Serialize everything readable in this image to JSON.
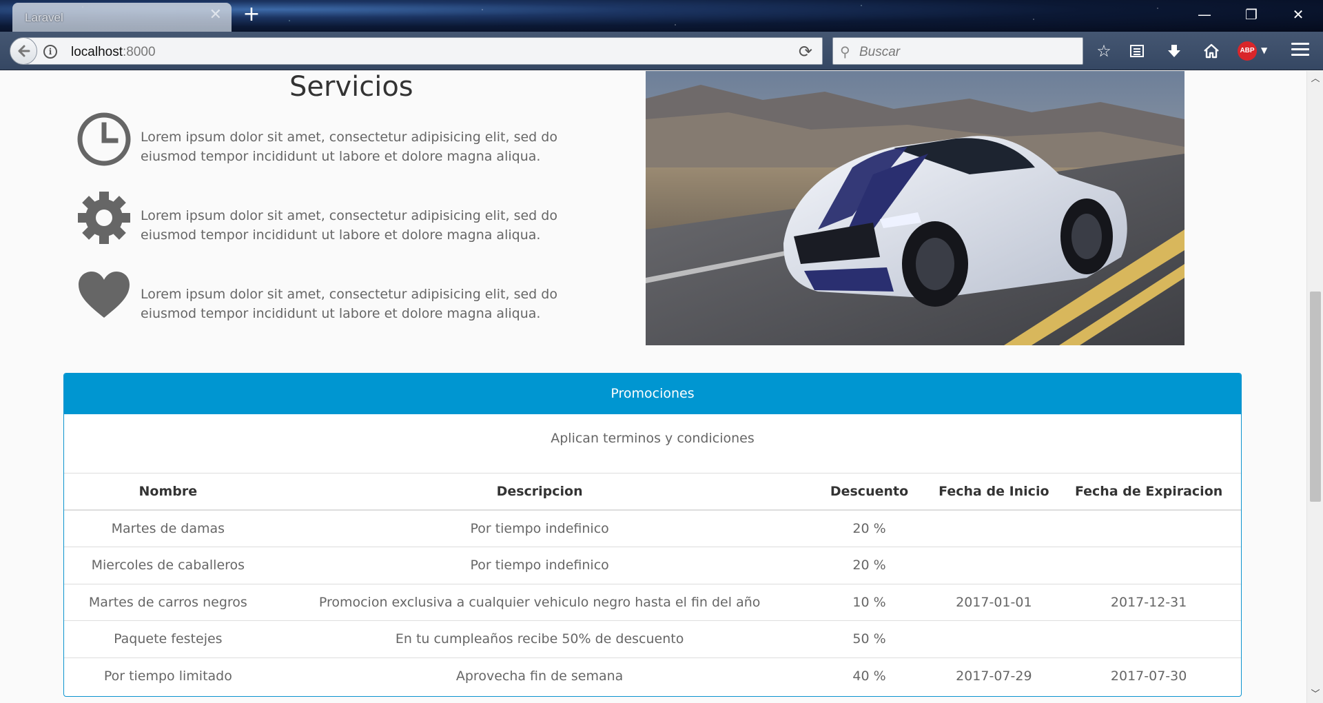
{
  "browser": {
    "tab_title": "Laravel",
    "url_host": "localhost",
    "url_port": ":8000",
    "search_placeholder": "Buscar",
    "abp_label": "ABP",
    "window_controls": [
      "minimize-icon",
      "restore-icon",
      "close-icon"
    ],
    "toolbar_icons": [
      "bookmark-star-icon",
      "reading-list-icon",
      "download-icon",
      "home-icon",
      "adblock-icon",
      "hamburger-menu-icon"
    ]
  },
  "servicios": {
    "title": "Servicios",
    "items": [
      {
        "icon": "clock-icon",
        "text": "Lorem ipsum dolor sit amet, consectetur adipisicing elit, sed do eiusmod tempor incididunt ut labore et dolore magna aliqua."
      },
      {
        "icon": "gear-icon",
        "text": "Lorem ipsum dolor sit amet, consectetur adipisicing elit, sed do eiusmod tempor incididunt ut labore et dolore magna aliqua."
      },
      {
        "icon": "heart-icon",
        "text": "Lorem ipsum dolor sit amet, consectetur adipisicing elit, sed do eiusmod tempor incididunt ut labore et dolore magna aliqua."
      }
    ]
  },
  "promociones": {
    "heading": "Promociones",
    "subtitle": "Aplican terminos y condiciones",
    "columns": [
      "Nombre",
      "Descripcion",
      "Descuento",
      "Fecha de Inicio",
      "Fecha de Expiracion"
    ],
    "rows": [
      [
        "Martes de damas",
        "Por tiempo indefinico",
        "20 %",
        "",
        ""
      ],
      [
        "Miercoles de caballeros",
        "Por tiempo indefinico",
        "20 %",
        "",
        ""
      ],
      [
        "Martes de carros negros",
        "Promocion exclusiva a cualquier vehiculo negro hasta el fin del año",
        "10 %",
        "2017-01-01",
        "2017-12-31"
      ],
      [
        "Paquete festejes",
        "En tu cumpleaños recibe 50% de descuento",
        "50 %",
        "",
        ""
      ],
      [
        "Por tiempo limitado",
        "Aprovecha fin de semana",
        "40 %",
        "2017-07-29",
        "2017-07-30"
      ]
    ]
  },
  "colors": {
    "panel_header": "#0096d1",
    "icon_gray": "#666666"
  }
}
